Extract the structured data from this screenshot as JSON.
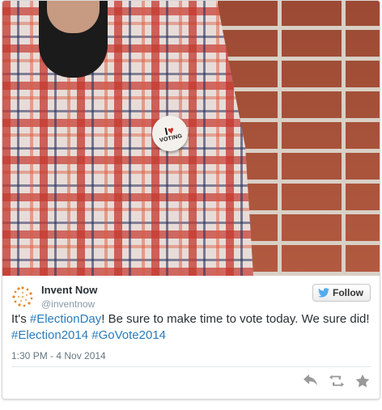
{
  "photo": {
    "pin_line1": "I",
    "pin_line2": "VOTING"
  },
  "tweet": {
    "author_name": "Invent Now",
    "author_handle": "@inventnow",
    "follow_label": "Follow",
    "text_prefix": "It's ",
    "hashtag_1": "#ElectionDay",
    "text_middle": "! Be sure to make time to vote today. We sure did! ",
    "hashtag_2": "#Election2014",
    "hashtag_3": "#GoVote2014",
    "timestamp": "1:30 PM - 4 Nov 2014",
    "actions": [
      "reply",
      "retweet",
      "favorite"
    ]
  },
  "colors": {
    "hashtag": "#2b7bb9",
    "text": "#292f33",
    "muted": "#8899a6",
    "action_icon": "#999999",
    "follow_bird": "#55acee"
  }
}
